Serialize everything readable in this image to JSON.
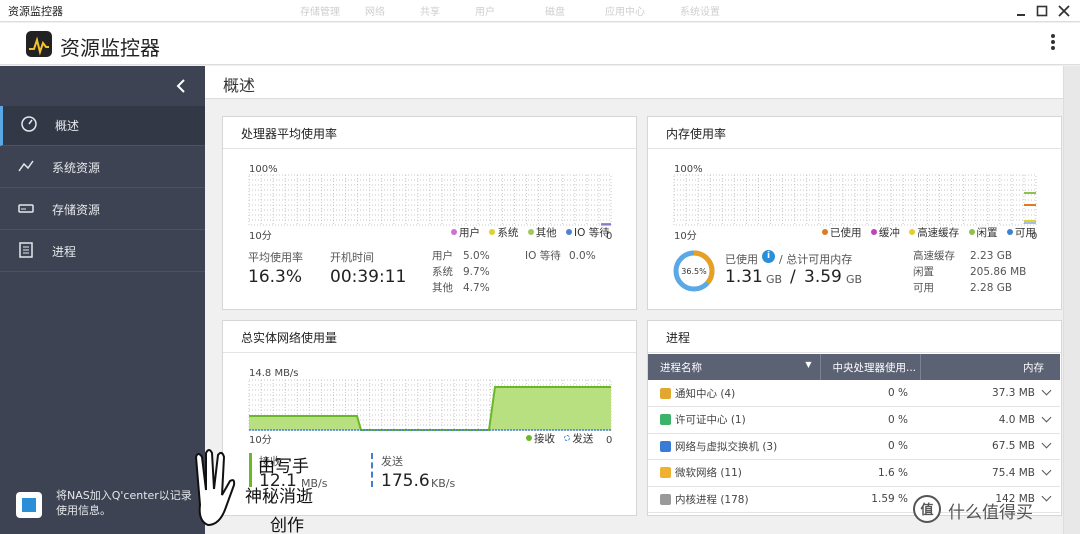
{
  "window": {
    "title": "资源监控器",
    "ghost_tabs": [
      "存储管理",
      "网络",
      "共享",
      "用户",
      "磁盘",
      "应用中心",
      "系统设置"
    ]
  },
  "header": {
    "app_name": "资源监控器"
  },
  "sidebar": {
    "items": [
      {
        "label": "概述",
        "icon": "dashboard-icon",
        "active": true
      },
      {
        "label": "系统资源",
        "icon": "trend-icon",
        "active": false
      },
      {
        "label": "存储资源",
        "icon": "storage-icon",
        "active": false
      },
      {
        "label": "进程",
        "icon": "list-icon",
        "active": false
      }
    ],
    "promo_text": "将NAS加入Q'center以记录使用信息。"
  },
  "page": {
    "title": "概述"
  },
  "cpu": {
    "title": "处理器平均使用率",
    "y_top": "100%",
    "x_label": "10分",
    "zero": "0",
    "legend": [
      {
        "label": "用户",
        "color": "#d070d0"
      },
      {
        "label": "系统",
        "color": "#e0d030"
      },
      {
        "label": "其他",
        "color": "#a0c860"
      },
      {
        "label": "IO 等待",
        "color": "#5080d0"
      }
    ],
    "avg_label": "平均使用率",
    "avg_value": "16.3%",
    "uptime_label": "开机时间",
    "uptime_value": "00:39:11",
    "stats": [
      {
        "k": "用户",
        "v": "5.0%"
      },
      {
        "k": "系统",
        "v": "9.7%"
      },
      {
        "k": "其他",
        "v": "4.7%"
      }
    ],
    "io_label": "IO 等待",
    "io_value": "0.0%"
  },
  "memory": {
    "title": "内存使用率",
    "y_top": "100%",
    "x_label": "10分",
    "zero": "0",
    "legend": [
      {
        "label": "已使用",
        "color": "#e07a20"
      },
      {
        "label": "缓冲",
        "color": "#c040c0"
      },
      {
        "label": "高速缓存",
        "color": "#e0d030"
      },
      {
        "label": "闲置",
        "color": "#90c050"
      },
      {
        "label": "可用",
        "color": "#4080d0"
      }
    ],
    "donut_percent": "36.5%",
    "donut_fraction": 0.365,
    "used_label": "已使用",
    "info_glyph": "i",
    "total_label": "/ 总计可用内存",
    "used_value": "1.31",
    "used_unit": "GB",
    "sep": "/",
    "total_value": "3.59",
    "total_unit": "GB",
    "stats": [
      {
        "k": "高速缓存",
        "v": "2.23 GB"
      },
      {
        "k": "闲置",
        "v": "205.86 MB"
      },
      {
        "k": "可用",
        "v": "2.28 GB"
      }
    ]
  },
  "network": {
    "title": "总实体网络使用量",
    "y_top": "14.8 MB/s",
    "x_label": "10分",
    "zero": "0",
    "legend_rx": "接收",
    "legend_tx": "发送",
    "rx_label": "接收",
    "rx_value": "12.1",
    "rx_unit": "MB/s",
    "tx_label": "发送",
    "tx_value": "175.6",
    "tx_unit": "KB/s"
  },
  "processes": {
    "title": "进程",
    "columns": [
      "进程名称",
      "中央处理器使用...",
      "内存"
    ],
    "rows": [
      {
        "name": "通知中心 (4)",
        "cpu": "0 %",
        "mem": "37.3 MB",
        "icon_color": "#e2a72e"
      },
      {
        "name": "许可证中心 (1)",
        "cpu": "0 %",
        "mem": "4.0 MB",
        "icon_color": "#3bb36b"
      },
      {
        "name": "网络与虚拟交换机 (3)",
        "cpu": "0 %",
        "mem": "67.5 MB",
        "icon_color": "#3a7bd5"
      },
      {
        "name": "微软网络 (11)",
        "cpu": "1.6 %",
        "mem": "75.4 MB",
        "icon_color": "#f0b030"
      },
      {
        "name": "内核进程 (178)",
        "cpu": "1.59 %",
        "mem": "142 MB",
        "icon_color": "#999999"
      }
    ]
  },
  "watermark": {
    "line1": "由写手",
    "line2": "神秘消逝",
    "line3": "创作",
    "site": "什么值得买"
  }
}
